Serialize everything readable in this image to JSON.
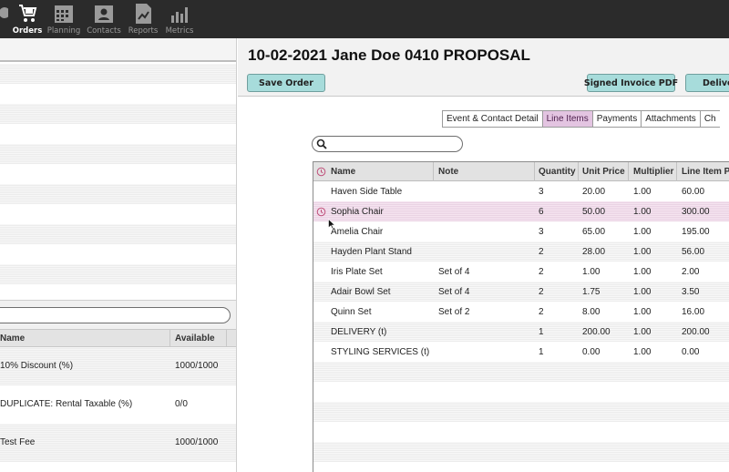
{
  "nav": {
    "items": [
      {
        "label": "",
        "icon": "partial-icon"
      },
      {
        "label": "Orders",
        "icon": "cart-icon"
      },
      {
        "label": "Planning",
        "icon": "calendar-icon"
      },
      {
        "label": "Contacts",
        "icon": "contact-card-icon"
      },
      {
        "label": "Reports",
        "icon": "report-chart-icon"
      },
      {
        "label": "Metrics",
        "icon": "bar-chart-icon"
      }
    ]
  },
  "left_panel": {
    "search_placeholder": "",
    "columns": [
      "Name",
      "Available"
    ],
    "rows": [
      {
        "name": "10% Discount (%)",
        "available": "1000/1000"
      },
      {
        "name": "DUPLICATE: Rental Taxable (%)",
        "available": "0/0"
      },
      {
        "name": "Test Fee",
        "available": "1000/1000"
      }
    ]
  },
  "order": {
    "title": "10-02-2021 Jane Doe 0410 PROPOSAL",
    "buttons": {
      "save": "Save Order",
      "signed_pdf": "Signed Invoice PDF",
      "deliver": "Deliver"
    },
    "tabs": [
      "Event & Contact Detail",
      "Line Items",
      "Payments",
      "Attachments",
      "Ch"
    ],
    "active_tab": "Line Items",
    "search_placeholder": ""
  },
  "line_items": {
    "columns": [
      "Name",
      "Note",
      "Quantity",
      "Unit Price",
      "Multiplier",
      "Line Item Pr"
    ],
    "rows": [
      {
        "name": "Haven Side Table",
        "note": "",
        "quantity": "3",
        "unit_price": "20.00",
        "multiplier": "1.00",
        "line_price": "60.00"
      },
      {
        "name": "Sophia Chair",
        "note": "",
        "quantity": "6",
        "unit_price": "50.00",
        "multiplier": "1.00",
        "line_price": "300.00"
      },
      {
        "name": "Amelia Chair",
        "note": "",
        "quantity": "3",
        "unit_price": "65.00",
        "multiplier": "1.00",
        "line_price": "195.00"
      },
      {
        "name": "Hayden Plant Stand",
        "note": "",
        "quantity": "2",
        "unit_price": "28.00",
        "multiplier": "1.00",
        "line_price": "56.00"
      },
      {
        "name": "Iris Plate Set",
        "note": "Set of 4",
        "quantity": "2",
        "unit_price": "1.00",
        "multiplier": "1.00",
        "line_price": "2.00"
      },
      {
        "name": "Adair Bowl Set",
        "note": "Set of 4",
        "quantity": "2",
        "unit_price": "1.75",
        "multiplier": "1.00",
        "line_price": "3.50"
      },
      {
        "name": "Quinn Set",
        "note": "Set of 2",
        "quantity": "2",
        "unit_price": "8.00",
        "multiplier": "1.00",
        "line_price": "16.00"
      },
      {
        "name": "DELIVERY (t)",
        "note": "",
        "quantity": "1",
        "unit_price": "200.00",
        "multiplier": "1.00",
        "line_price": "200.00"
      },
      {
        "name": "STYLING SERVICES (t)",
        "note": "",
        "quantity": "1",
        "unit_price": "0.00",
        "multiplier": "1.00",
        "line_price": "0.00"
      }
    ]
  },
  "colors": {
    "nav_bg": "#2b2b2b",
    "button_teal": "#a7dcdb",
    "tab_active": "#e3c4e1",
    "row_selected": "#f5e4f0",
    "clock_icon": "#c0507a"
  }
}
